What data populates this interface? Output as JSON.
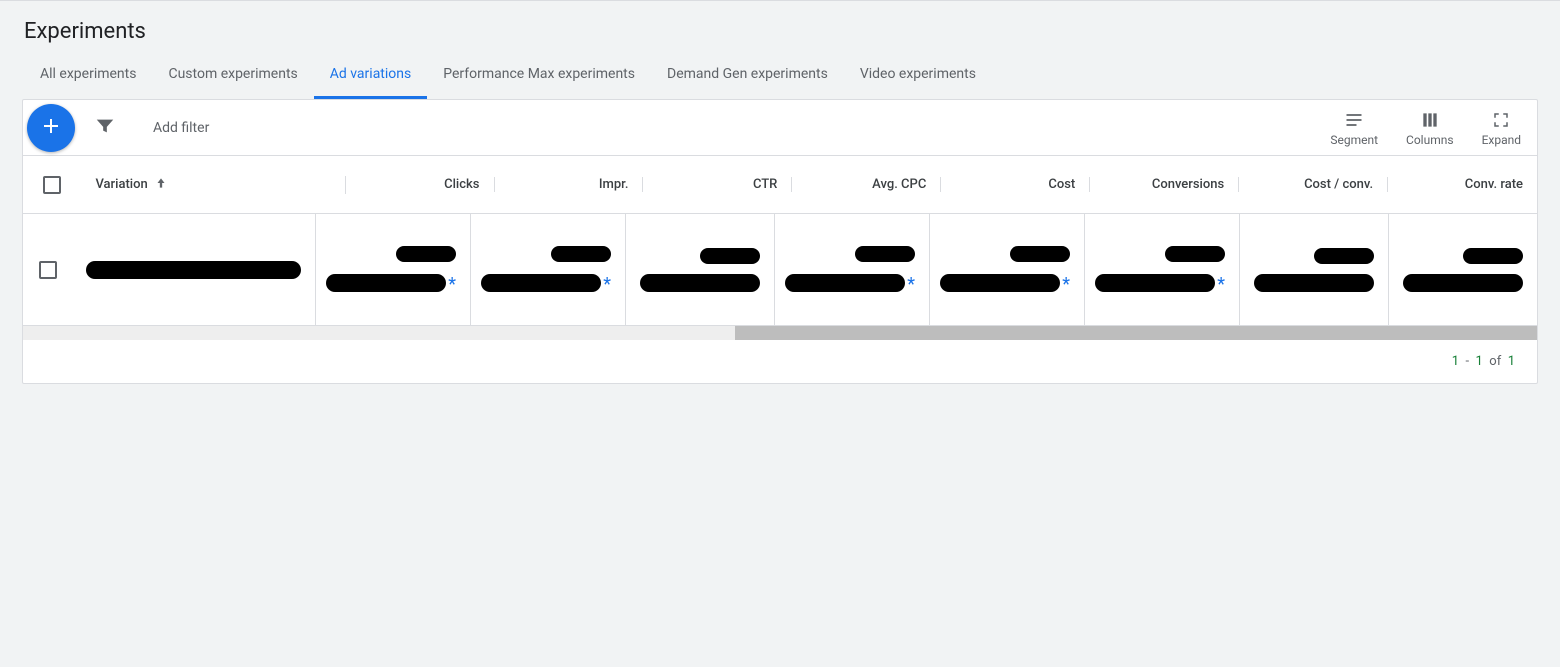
{
  "page": {
    "title": "Experiments"
  },
  "tabs": [
    {
      "label": "All experiments"
    },
    {
      "label": "Custom experiments"
    },
    {
      "label": "Ad variations"
    },
    {
      "label": "Performance Max experiments"
    },
    {
      "label": "Demand Gen experiments"
    },
    {
      "label": "Video experiments"
    }
  ],
  "active_tab_index": 2,
  "toolbar": {
    "add_filter_label": "Add filter",
    "segment_label": "Segment",
    "columns_label": "Columns",
    "expand_label": "Expand"
  },
  "columns": [
    {
      "label": "Variation",
      "align": "left",
      "sort": "asc"
    },
    {
      "label": "Clicks",
      "align": "right"
    },
    {
      "label": "Impr.",
      "align": "right"
    },
    {
      "label": "CTR",
      "align": "right"
    },
    {
      "label": "Avg. CPC",
      "align": "right"
    },
    {
      "label": "Cost",
      "align": "right"
    },
    {
      "label": "Conversions",
      "align": "right"
    },
    {
      "label": "Cost / conv.",
      "align": "right"
    },
    {
      "label": "Conv. rate",
      "align": "right"
    }
  ],
  "rows": [
    {
      "variation_name": "████████████████",
      "clicks": {
        "line1": "████",
        "line2": "████████",
        "asterisk": true
      },
      "impr": {
        "line1": "████",
        "line2": "████████",
        "asterisk": true
      },
      "ctr": {
        "line1": "████",
        "line2": "████████",
        "asterisk": false
      },
      "avg_cpc": {
        "line1": "████",
        "line2": "████████",
        "asterisk": true
      },
      "cost": {
        "line1": "████",
        "line2": "████████",
        "asterisk": true
      },
      "conversions": {
        "line1": "████",
        "line2": "████████",
        "asterisk": true
      },
      "cost_conv": {
        "line1": "████",
        "line2": "████████",
        "asterisk": false
      },
      "conv_rate": {
        "line1": "████",
        "line2": "████████",
        "asterisk": false
      }
    }
  ],
  "footer": {
    "range_start": "1",
    "range_end": "1",
    "of_label": "of",
    "total": "1"
  }
}
